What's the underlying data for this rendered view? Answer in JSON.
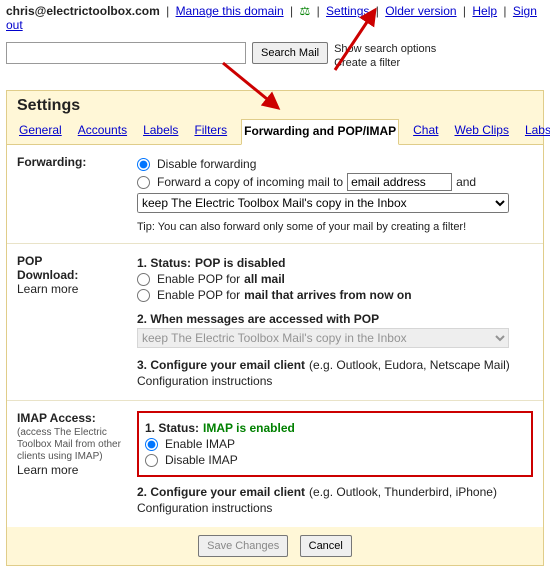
{
  "topbar": {
    "email": "chris@electrictoolbox.com",
    "manage": "Manage this domain",
    "settings": "Settings",
    "older": "Older version",
    "help": "Help",
    "signout": "Sign out"
  },
  "search": {
    "button": "Search Mail",
    "show_opts": "Show search options",
    "create_filter": "Create a filter"
  },
  "panel": {
    "title": "Settings"
  },
  "tabs": {
    "general": "General",
    "accounts": "Accounts",
    "labels": "Labels",
    "filters": "Filters",
    "fwd": "Forwarding and POP/IMAP",
    "chat": "Chat",
    "webclips": "Web Clips",
    "labs": "Labs"
  },
  "fwd": {
    "label": "Forwarding:",
    "disable": "Disable forwarding",
    "forward_prefix": "Forward a copy of incoming mail to",
    "email_value": "email address",
    "and": "and",
    "keep": "keep The Electric Toolbox Mail's copy in the Inbox",
    "tip_prefix": "Tip: You can also forward only some of your mail by ",
    "tip_link": "creating a filter!"
  },
  "pop": {
    "label1": "POP",
    "label2": "Download:",
    "learn": "Learn more",
    "status_lead": "1. Status: ",
    "status_val": "POP is disabled",
    "enable_all_pre": "Enable POP for ",
    "enable_all_b": "all mail",
    "enable_now_pre": "Enable POP for ",
    "enable_now_b": "mail that arrives from now on",
    "when": "2. When messages are accessed with POP",
    "keep": "keep The Electric Toolbox Mail's copy in the Inbox",
    "conf_lead": "3. Configure your email client",
    "conf_ex": " (e.g. Outlook, Eudora, Netscape Mail)",
    "conf_link": "Configuration instructions"
  },
  "imap": {
    "label": "IMAP Access:",
    "sub": "(access The Electric Toolbox Mail from other clients using IMAP)",
    "learn": "Learn more",
    "status_lead": "1. Status: ",
    "status_val": "IMAP is enabled",
    "enable": "Enable IMAP",
    "disable": "Disable IMAP",
    "conf_lead": "2. Configure your email client",
    "conf_ex": " (e.g. Outlook, Thunderbird, iPhone)",
    "conf_link": "Configuration instructions"
  },
  "buttons": {
    "save": "Save Changes",
    "cancel": "Cancel"
  }
}
